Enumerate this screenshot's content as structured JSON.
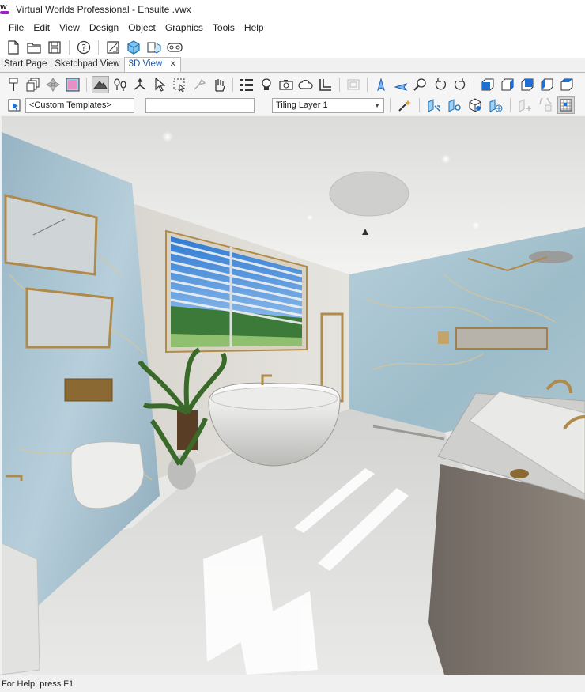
{
  "window": {
    "title": "Virtual Worlds Professional - Ensuite .vwx",
    "logo_letter": "W"
  },
  "menu": [
    "File",
    "Edit",
    "View",
    "Design",
    "Object",
    "Graphics",
    "Tools",
    "Help"
  ],
  "tabs": [
    {
      "label": "Start Page",
      "active": false
    },
    {
      "label": "Sketchpad View",
      "active": false
    },
    {
      "label": "3D View",
      "active": true
    }
  ],
  "tab_close": "✕",
  "toolbar3": {
    "template_value": "<Custom Templates>",
    "blank_value": "",
    "layer_value": "Tiling Layer 1"
  },
  "colors": {
    "accent": "#1558b0",
    "brand": "#a020c8",
    "tool_blue": "#2a7ad6"
  },
  "icons": {
    "toolbar1": [
      "new-file-icon",
      "open-folder-icon",
      "save-icon",
      "help-icon",
      "sketchpad-view-icon",
      "3d-view-icon",
      "sketchpad-3d-icon",
      "vr-headset-icon"
    ],
    "toolbar2": [
      "paint-brush-icon",
      "layers-icon",
      "hinge-icon",
      "material-icon",
      "walk-icon",
      "footprints-icon",
      "move-axes-icon",
      "pointer-icon",
      "select-box-icon",
      "lamp-icon",
      "hand-icon",
      "list-icon",
      "light-bulb-icon",
      "camera-icon",
      "cloud-icon",
      "floor-plan-icon",
      "window-icon",
      "rotate-left-icon",
      "rotate-right-icon",
      "zoom-icon",
      "orbit-left-icon",
      "orbit-right-icon",
      "view-front-icon",
      "view-right-icon",
      "view-back-icon",
      "view-left-icon",
      "view-top-icon"
    ],
    "toolbar3": [
      "template-select-icon",
      "magic-wand-icon",
      "tile-layout-icon",
      "tile-move-icon",
      "tile-rotate-icon",
      "tile-grid-icon",
      "tile-add-icon",
      "tile-delete-icon",
      "grid-view-icon"
    ]
  },
  "status": {
    "text": "For Help, press F1"
  }
}
